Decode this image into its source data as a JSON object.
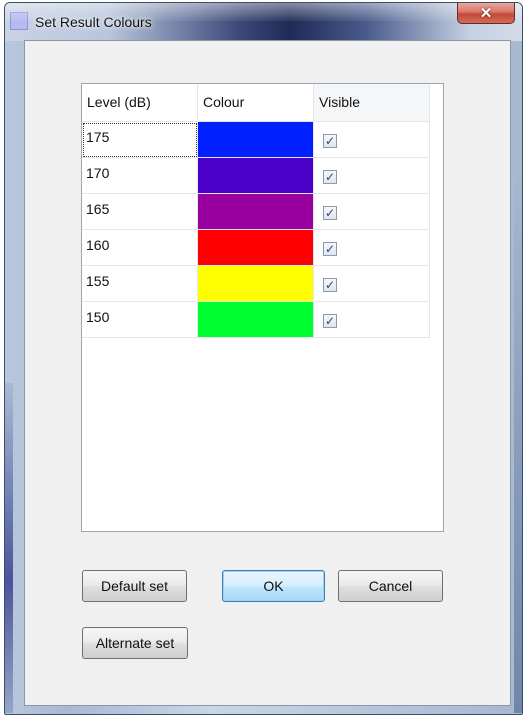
{
  "window": {
    "title": "Set Result Colours",
    "close_glyph": "✕"
  },
  "grid": {
    "columns": [
      "Level (dB)",
      "Colour",
      "Visible"
    ],
    "rows": [
      {
        "level": "175",
        "colour": "#0020ff",
        "visible": true
      },
      {
        "level": "170",
        "colour": "#4a00c8",
        "visible": true
      },
      {
        "level": "165",
        "colour": "#9800a0",
        "visible": true
      },
      {
        "level": "160",
        "colour": "#ff0000",
        "visible": true
      },
      {
        "level": "155",
        "colour": "#ffff00",
        "visible": true
      },
      {
        "level": "150",
        "colour": "#00ff30",
        "visible": true
      }
    ],
    "check_glyph": "✓"
  },
  "buttons": {
    "default_set": "Default set",
    "ok": "OK",
    "cancel": "Cancel",
    "alternate_set": "Alternate set"
  }
}
